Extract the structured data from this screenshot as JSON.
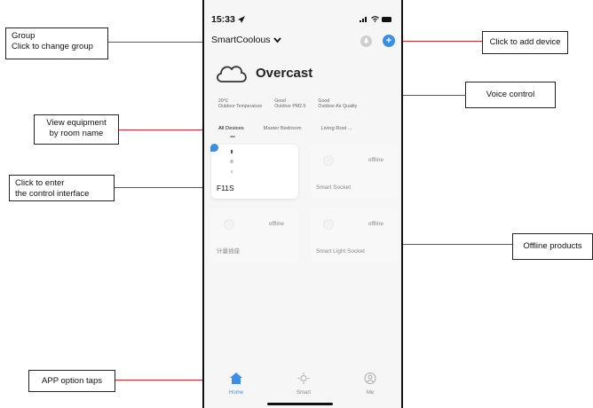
{
  "status": {
    "time": "15:33"
  },
  "header": {
    "group_name": "SmartCoolous"
  },
  "weather": {
    "condition": "Overcast",
    "stats": [
      {
        "value": "20℃",
        "label": "Outdoor Temperature"
      },
      {
        "value": "Good",
        "label": "Outdoor PM2.5"
      },
      {
        "value": "Good",
        "label": "Outdoor Air Quality"
      }
    ]
  },
  "rooms": [
    "All Devices",
    "Master Bedroom",
    "Living Rool ..."
  ],
  "devices": [
    {
      "name": "F11S",
      "status": ""
    },
    {
      "name": "Smart Socket",
      "status": "offline"
    },
    {
      "name": "计量插座",
      "status": "offline"
    },
    {
      "name": "Smart Light Socket",
      "status": "offline"
    }
  ],
  "nav": [
    {
      "label": "Home",
      "icon": "home-icon"
    },
    {
      "label": "Smart",
      "icon": "sun-icon"
    },
    {
      "label": "Me",
      "icon": "user-icon"
    }
  ],
  "callouts": {
    "group": "Group\nClick to change group",
    "add": "Click to add device",
    "voice": "Voice control",
    "room": "View equipment\nby room name",
    "control": "Click to enter\nthe control interface",
    "offline": "Offline products",
    "taps": "APP option taps"
  },
  "colors": {
    "accent": "#3a8ee6",
    "callout_line": "#d4262b"
  }
}
